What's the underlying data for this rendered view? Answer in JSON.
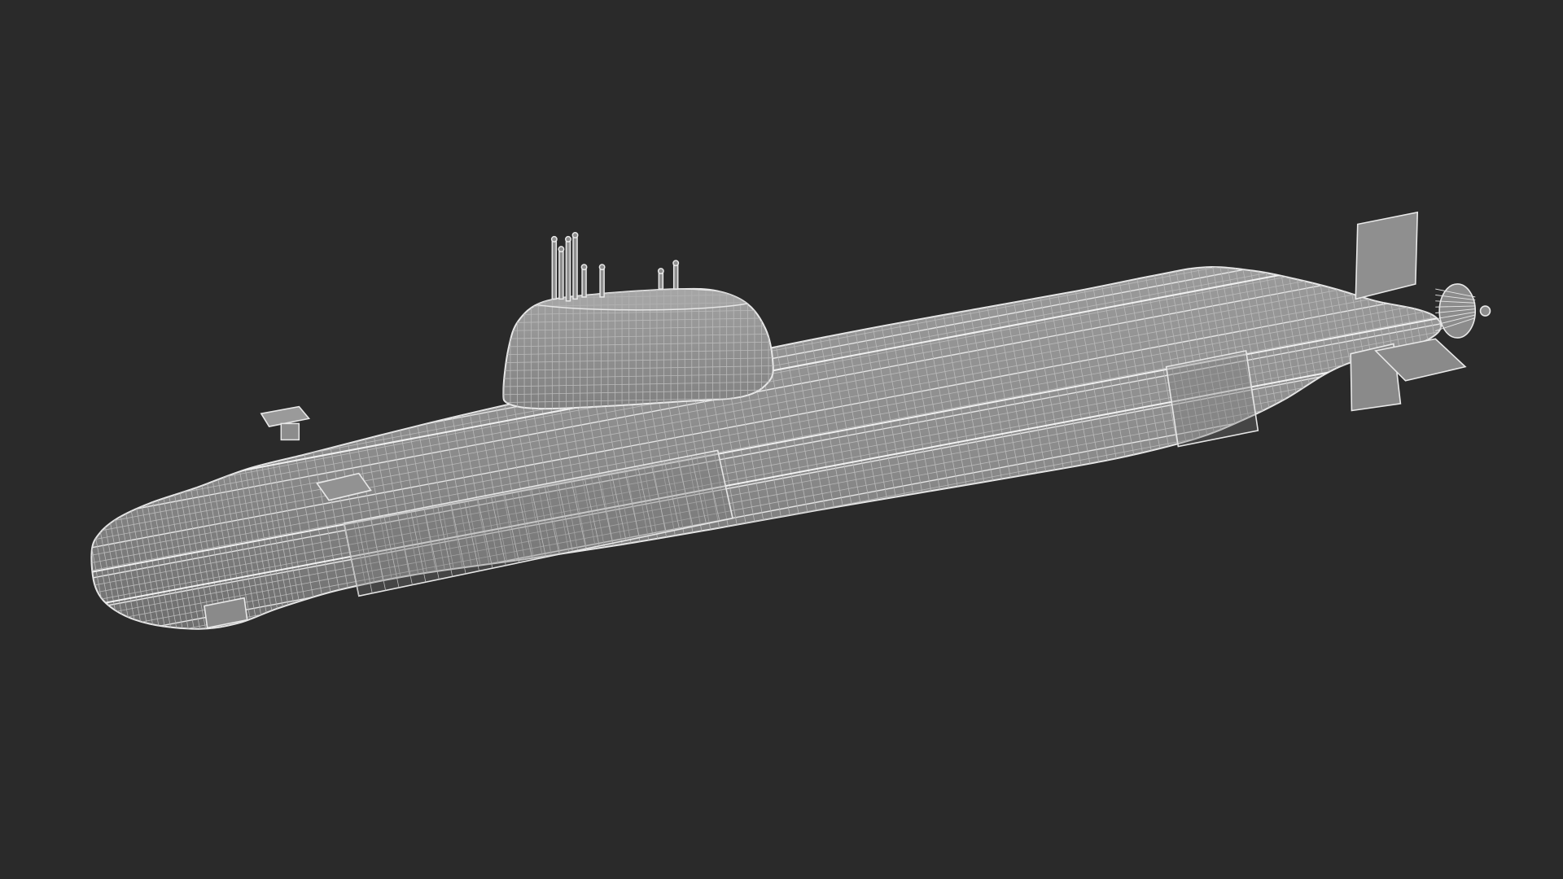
{
  "scene": {
    "subject": "submarine-wireframe",
    "background_color": "#2a2a2a",
    "hull_fill": "#8d8d8d",
    "hull_shade": "#6f6f6f",
    "wire_color": "#e6e6e6",
    "wire_dark": "#b9b9b9"
  }
}
